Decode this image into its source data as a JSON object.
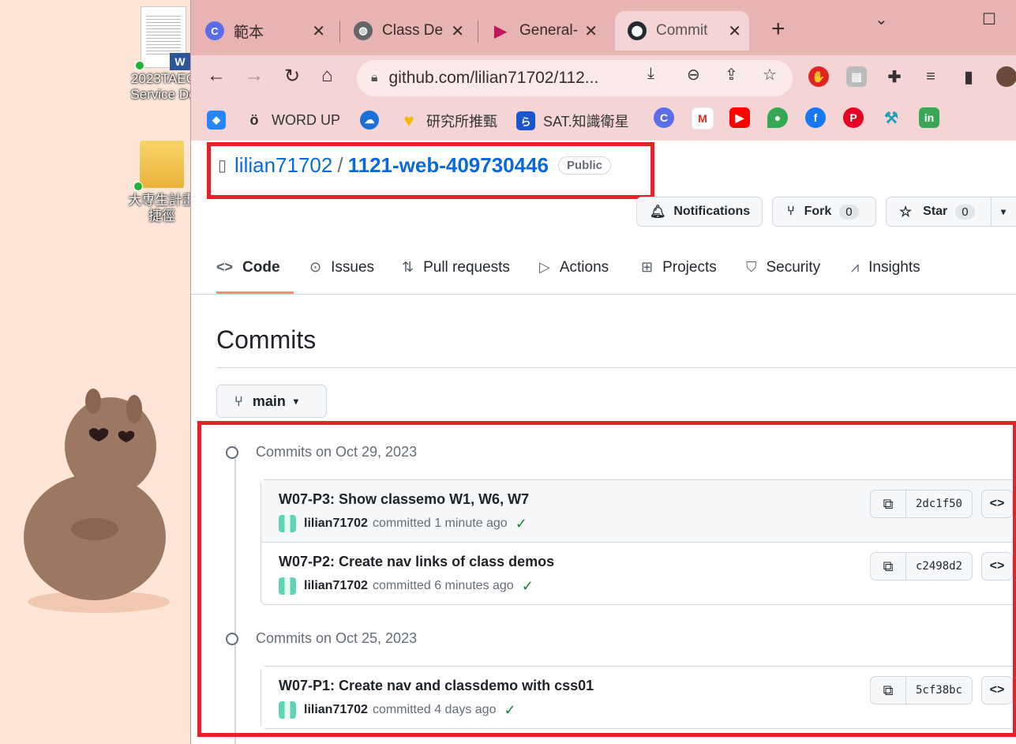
{
  "desktop": {
    "icons": [
      {
        "label_line1": "2023TAEC",
        "label_line2": "Service De",
        "badge": "W"
      },
      {
        "label_line1": "大專生計畫",
        "label_line2": "捷徑"
      }
    ]
  },
  "browser": {
    "tabs": [
      {
        "title": "範本",
        "favicon": "C"
      },
      {
        "title": "Class De",
        "favicon": "globe"
      },
      {
        "title": "General-",
        "favicon": "▶"
      },
      {
        "title": "Commit",
        "favicon": "github",
        "active": true
      }
    ],
    "new_tab": "+",
    "url": "github.com/lilian71702/112...",
    "bookmarks": [
      {
        "label": ""
      },
      {
        "label": "WORD UP"
      },
      {
        "label": ""
      },
      {
        "label": "研究所推甄"
      },
      {
        "label": "SAT.知識衛星"
      }
    ]
  },
  "repo": {
    "owner": "lilian71702",
    "slash": "/",
    "name": "1121-web-409730446",
    "visibility": "Public",
    "notifications_label": "Notifications",
    "fork_label": "Fork",
    "fork_count": "0",
    "star_label": "Star",
    "star_count": "0"
  },
  "repo_nav": [
    {
      "label": "Code",
      "icon": "code-icon",
      "selected": true
    },
    {
      "label": "Issues",
      "icon": "issue-icon"
    },
    {
      "label": "Pull requests",
      "icon": "pull-request-icon"
    },
    {
      "label": "Actions",
      "icon": "play-icon"
    },
    {
      "label": "Projects",
      "icon": "table-icon"
    },
    {
      "label": "Security",
      "icon": "shield-icon"
    },
    {
      "label": "Insights",
      "icon": "graph-icon"
    }
  ],
  "commits_page": {
    "title": "Commits",
    "branch": "main",
    "groups": [
      {
        "date_label": "Commits on Oct 29, 2023",
        "commits": [
          {
            "message": "W07-P3: Show classemo W1, W6, W7",
            "author": "lilian71702",
            "time": "committed 1 minute ago",
            "sha": "2dc1f50"
          },
          {
            "message": "W07-P2: Create nav links of class demos",
            "author": "lilian71702",
            "time": "committed 6 minutes ago",
            "sha": "c2498d2"
          }
        ]
      },
      {
        "date_label": "Commits on Oct 25, 2023",
        "commits": [
          {
            "message": "W07-P1: Create nav and classdemo with css01",
            "author": "lilian71702",
            "time": "committed 4 days ago",
            "sha": "5cf38bc"
          }
        ]
      }
    ]
  },
  "colors": {
    "highlight_box": "#e8202a",
    "link": "#0969da",
    "tab_bar": "#e8b3b3"
  }
}
